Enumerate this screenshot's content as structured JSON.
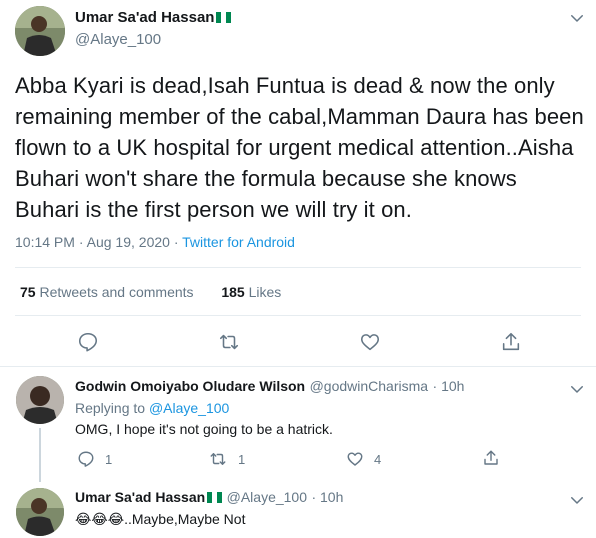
{
  "tweet": {
    "author_name": "Umar Sa'ad Hassan",
    "author_handle": "@Alaye_100",
    "text": "Abba Kyari is dead,Isah Funtua is dead & now the only remaining member of the cabal,Mamman Daura has been flown to a UK hospital for urgent medical attention..Aisha Buhari won't share the formula because she knows Buhari is the first person we will try it on.",
    "time": "10:14 PM",
    "date": "Aug 19, 2020",
    "separator": "·",
    "source": "Twitter for Android",
    "retweets_count": "75",
    "retweets_label": "Retweets and comments",
    "likes_count": "185",
    "likes_label": "Likes"
  },
  "replies": [
    {
      "author_name": "Godwin Omoiyabo Oludare Wilson",
      "author_handle": "@godwinCharisma",
      "time": "· 10h",
      "replying_prefix": "Replying to",
      "replying_to": "@Alaye_100",
      "text": "OMG, I hope it's not going to be a hatrick.",
      "reply_count": "1",
      "retweet_count": "1",
      "like_count": "4"
    },
    {
      "author_name": "Umar Sa'ad Hassan",
      "author_handle": "@Alaye_100",
      "time": "· 10h",
      "emoji": "😂😂😂",
      "text": "..Maybe,Maybe Not"
    }
  ],
  "colors": {
    "accent": "#1b95e0",
    "muted": "#657786",
    "text": "#14171a",
    "flag_green": "#008751"
  },
  "icons": [
    "chevron-down-icon",
    "reply-icon",
    "retweet-icon",
    "like-icon",
    "share-icon",
    "nigeria-flag-icon"
  ]
}
